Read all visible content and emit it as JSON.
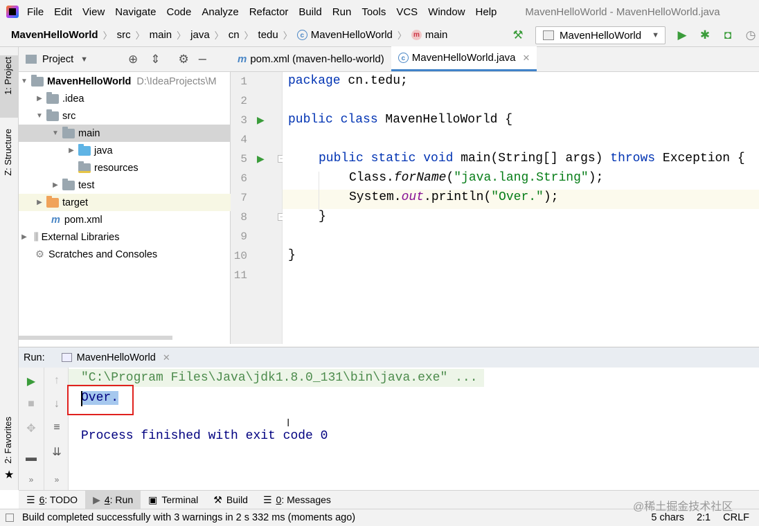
{
  "menu": {
    "items": [
      "File",
      "Edit",
      "View",
      "Navigate",
      "Code",
      "Analyze",
      "Refactor",
      "Build",
      "Run",
      "Tools",
      "VCS",
      "Window",
      "Help"
    ]
  },
  "window_title": "MavenHelloWorld - MavenHelloWorld.java",
  "breadcrumb": {
    "items": [
      "MavenHelloWorld",
      "src",
      "main",
      "java",
      "cn",
      "tedu",
      "MavenHelloWorld",
      "main"
    ]
  },
  "run_config": "MavenHelloWorld",
  "left_strip": {
    "project": "1: Project",
    "structure": "Z: Structure",
    "favorites": "2: Favorites"
  },
  "project_panel": {
    "title": "Project",
    "root_name": "MavenHelloWorld",
    "root_path": "D:\\IdeaProjects\\M",
    "items": [
      ".idea",
      "src",
      "main",
      "java",
      "resources",
      "test",
      "target",
      "pom.xml",
      "External Libraries",
      "Scratches and Consoles"
    ]
  },
  "editor_tabs": [
    {
      "label": "pom.xml (maven-hello-world)"
    },
    {
      "label": "MavenHelloWorld.java"
    }
  ],
  "code": {
    "line_numbers": [
      "1",
      "2",
      "3",
      "4",
      "5",
      "6",
      "7",
      "8",
      "9",
      "10",
      "11"
    ],
    "l1_kw": "package",
    "l1_rest": " cn.tedu;",
    "l3_kw": "public class",
    "l3_rest": " MavenHelloWorld {",
    "l5_kw": "public static void",
    "l5_mid": " main(String[] args) ",
    "l5_kw2": "throws",
    "l5_rest": " Exception {",
    "l6_a": "Class.",
    "l6_it": "forName",
    "l6_b": "(",
    "l6_str": "\"java.lang.String\"",
    "l6_c": ");",
    "l7_a": "System.",
    "l7_fld": "out",
    "l7_b": ".println(",
    "l7_str": "\"Over.\"",
    "l7_c": ");",
    "l8": "}",
    "l10": "}"
  },
  "run_panel": {
    "label": "Run:",
    "tab": "MavenHelloWorld",
    "cmd": "\"C:\\Program Files\\Java\\jdk1.8.0_131\\bin\\java.exe\" ...",
    "output": "Over.",
    "finished": "Process finished with exit code 0"
  },
  "bottom_tabs": [
    {
      "num": "6",
      "label": ": TODO"
    },
    {
      "num": "4",
      "label": ": Run"
    },
    {
      "label": "Terminal"
    },
    {
      "label": "Build"
    },
    {
      "num": "0",
      "label": ": Messages"
    }
  ],
  "status": {
    "message": "Build completed successfully with 3 warnings in 2 s 332 ms (moments ago)",
    "chars": "5 chars",
    "position": "2:1",
    "line_ending": "CRLF",
    "watermark": "@稀土掘金技术社区"
  },
  "colors": {
    "keyword": "#0033b3",
    "string": "#067d17",
    "field": "#871094",
    "run_green": "#3a9c3a",
    "highlight_red": "#e0211e"
  }
}
